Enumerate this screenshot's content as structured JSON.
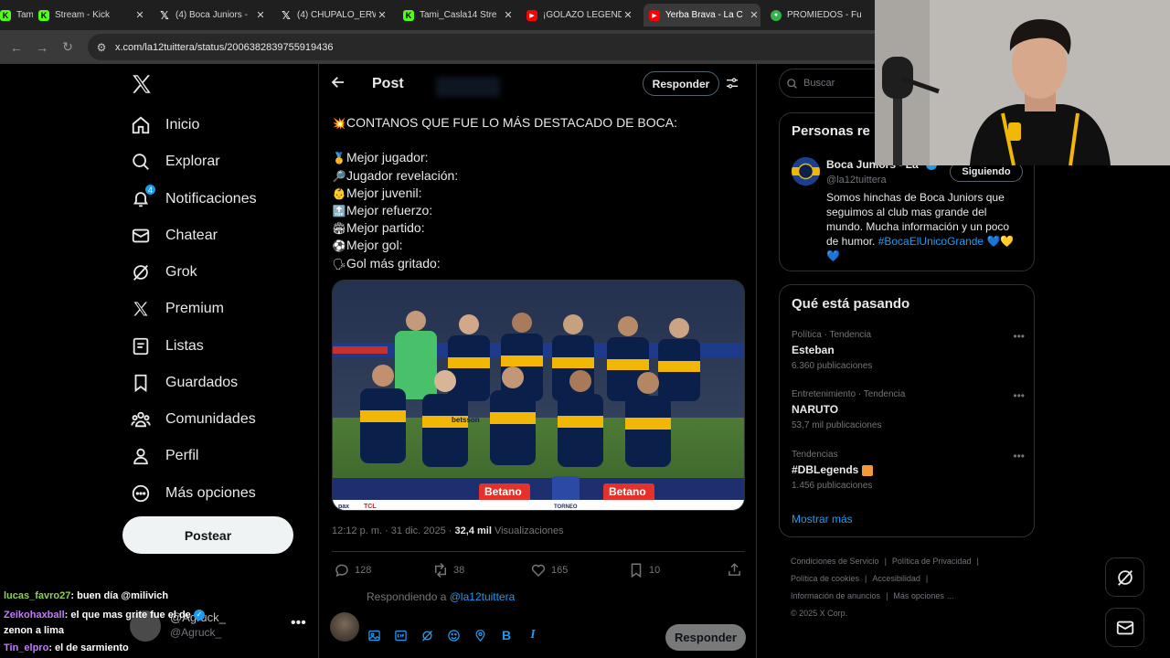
{
  "browser": {
    "tabs": [
      {
        "title": "Tami_Casla14",
        "active": false,
        "favicon_color": "#53fc18"
      },
      {
        "title": "Stream - Kick",
        "active": false,
        "favicon_color": "#53fc18"
      },
      {
        "title": "(4) Boca Juniors -",
        "active": false,
        "favicon_color": "#000000"
      },
      {
        "title": "(4) CHUPALO_ERW",
        "active": false,
        "favicon_color": "#000000"
      },
      {
        "title": "Tami_Casla14 Stre",
        "active": false,
        "favicon_color": "#53fc18"
      },
      {
        "title": "¡GOLAZO LEGEND",
        "active": false,
        "favicon_color": "#ff0000"
      },
      {
        "title": "Yerba Brava - La C",
        "active": true,
        "favicon_color": "#ff0000"
      },
      {
        "title": "PROMIEDOS - Fu",
        "active": false,
        "favicon_color": "#2fb34a"
      }
    ],
    "url": "x.com/la12tuittera/status/2006382839755919436"
  },
  "sidebar": {
    "items": [
      {
        "label": "Inicio",
        "icon": "home-icon"
      },
      {
        "label": "Explorar",
        "icon": "search-icon"
      },
      {
        "label": "Notificaciones",
        "icon": "bell-icon",
        "badge": "4"
      },
      {
        "label": "Chatear",
        "icon": "mail-icon"
      },
      {
        "label": "Grok",
        "icon": "grok-icon"
      },
      {
        "label": "Premium",
        "icon": "x-premium-icon"
      },
      {
        "label": "Listas",
        "icon": "list-icon"
      },
      {
        "label": "Guardados",
        "icon": "bookmark-icon"
      },
      {
        "label": "Comunidades",
        "icon": "communities-icon"
      },
      {
        "label": "Perfil",
        "icon": "person-icon"
      },
      {
        "label": "Más opciones",
        "icon": "more-circle-icon"
      }
    ],
    "post_button": "Postear",
    "account": {
      "name": "@Agruck_",
      "handle": "@Agruck_"
    }
  },
  "chat": [
    {
      "user": "lucas_favro27",
      "user_color": "#8fd14f",
      "message": ": buen día @milivich"
    },
    {
      "user": "Zeikohaxball",
      "user_color": "#c678ff",
      "message": ": el que mas grite fue el de"
    },
    {
      "user": "",
      "user_color": "#ffffff",
      "message": "zenon a lima"
    },
    {
      "user": "Tin_elpro",
      "user_color": "#c678ff",
      "message": ": el de sarmiento"
    }
  ],
  "post": {
    "header_title": "Post",
    "reply_button": "Responder",
    "headline": "CONTANOS QUE FUE LO MÁS DESTACADO DE BOCA:",
    "list": [
      {
        "emoji": "🥇",
        "text": "Mejor jugador:"
      },
      {
        "emoji": "🔎",
        "text": "Jugador revelación:"
      },
      {
        "emoji": "👶",
        "text": "Mejor juvenil:"
      },
      {
        "emoji": "🔝",
        "text": "Mejor refuerzo:"
      },
      {
        "emoji": "🏟",
        "text": "Mejor partido:"
      },
      {
        "emoji": "⚽",
        "text": "Mejor gol:"
      },
      {
        "emoji": "🗣",
        "text": "Gol más gritado:"
      }
    ],
    "time": "12:12 p. m. · 31 dic. 2025 · ",
    "views": "32,4 mil",
    "views_label": "Visualizaciones",
    "stats": {
      "replies": "128",
      "reposts": "38",
      "likes": "165",
      "bookmarks": "10"
    },
    "replying_to_label": "Respondiendo a ",
    "replying_to_handle": "@la12tuittera",
    "submit_reply": "Responder",
    "image": {
      "sponsor_1": "Betano",
      "sponsor_2": "Betano",
      "board_1": "TORNEO",
      "board_2": "pax",
      "board_3": "TCL",
      "jersey_sponsor": "betsson"
    }
  },
  "right": {
    "search_placeholder": "Buscar",
    "people_title": "Personas re",
    "profile": {
      "name": "Boca Juniors - La",
      "handle": "@la12tuittera",
      "follow_label": "Siguiendo",
      "bio": "Somos hinchas de Boca Juniors que seguimos al club mas grande del mundo. Mucha información y un poco de humor. ",
      "bio_hashtag": "#BocaElUnicoGrande",
      "bio_emojis": "💙💛💙"
    },
    "trends_title": "Qué está pasando",
    "trends": [
      {
        "context": "Política · Tendencia",
        "name": "Esteban",
        "count": "6.360 publicaciones"
      },
      {
        "context": "Entretenimiento · Tendencia",
        "name": "NARUTO",
        "count": "53,7 mil publicaciones"
      },
      {
        "context": "Tendencias",
        "name": "#DBLegends",
        "count": "1.456 publicaciones"
      }
    ],
    "show_more": "Mostrar más",
    "footer": [
      "Condiciones de Servicio",
      "Política de Privacidad",
      "Política de cookies",
      "Accesibilidad",
      "Información de anuncios",
      "Más opciones …",
      "© 2025 X Corp."
    ]
  }
}
